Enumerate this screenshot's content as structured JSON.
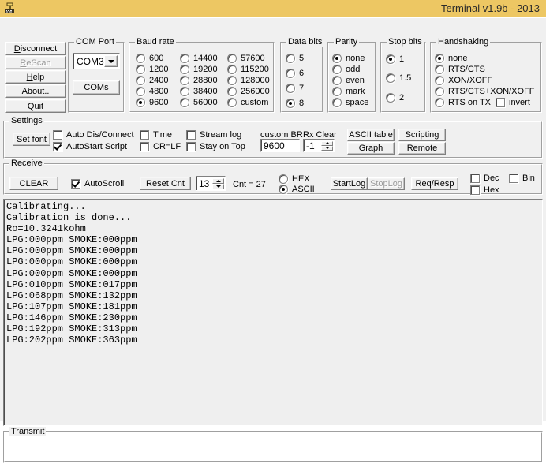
{
  "window": {
    "title": "Terminal v1.9b - 2013",
    "icon": "terminal-icon"
  },
  "connection_buttons": [
    {
      "name": "disconnect",
      "label": "Disconnect",
      "accel": "D",
      "disabled": false
    },
    {
      "name": "rescan",
      "label": "ReScan",
      "accel": "R",
      "disabled": true
    },
    {
      "name": "help",
      "label": "Help",
      "accel": "H",
      "disabled": false
    },
    {
      "name": "about",
      "label": "About..",
      "accel": "A",
      "disabled": false
    },
    {
      "name": "quit",
      "label": "Quit",
      "accel": "Q",
      "disabled": false
    }
  ],
  "com_port": {
    "legend": "COM Port",
    "selected": "COM3",
    "coms_button": "COMs"
  },
  "baud_rate": {
    "legend": "Baud rate",
    "selected": "9600",
    "columns": [
      [
        "600",
        "1200",
        "2400",
        "4800",
        "9600"
      ],
      [
        "14400",
        "19200",
        "28800",
        "38400",
        "56000"
      ],
      [
        "57600",
        "115200",
        "128000",
        "256000",
        "custom"
      ]
    ]
  },
  "data_bits": {
    "legend": "Data bits",
    "selected": "8",
    "options": [
      "5",
      "6",
      "7",
      "8"
    ]
  },
  "parity": {
    "legend": "Parity",
    "selected": "none",
    "options": [
      "none",
      "odd",
      "even",
      "mark",
      "space"
    ]
  },
  "stop_bits": {
    "legend": "Stop bits",
    "selected": "1",
    "options": [
      "1",
      "1.5",
      "2"
    ]
  },
  "handshaking": {
    "legend": "Handshaking",
    "selected": "none",
    "options": [
      "none",
      "RTS/CTS",
      "XON/XOFF",
      "RTS/CTS+XON/XOFF",
      "RTS on TX"
    ],
    "invert_label": "invert",
    "invert_checked": false
  },
  "settings": {
    "legend": "Settings",
    "set_font_button": "Set font",
    "checkboxes": [
      {
        "name": "auto-dis-connect",
        "label": "Auto Dis/Connect",
        "checked": false
      },
      {
        "name": "autostart-script",
        "label": "AutoStart Script",
        "checked": true
      },
      {
        "name": "time",
        "label": "Time",
        "checked": false
      },
      {
        "name": "cr-lf",
        "label": "CR=LF",
        "checked": false
      },
      {
        "name": "stream-log",
        "label": "Stream log",
        "checked": false
      },
      {
        "name": "stay-on-top",
        "label": "Stay on Top",
        "checked": false
      }
    ],
    "custom_br_label": "custom BR",
    "custom_br_value": "9600",
    "rx_clear_label": "Rx Clear",
    "rx_clear_value": "-1",
    "buttons": [
      {
        "name": "ascii-table",
        "label": "ASCII table"
      },
      {
        "name": "scripting",
        "label": "Scripting"
      },
      {
        "name": "graph",
        "label": "Graph"
      },
      {
        "name": "remote",
        "label": "Remote"
      }
    ]
  },
  "receive": {
    "legend": "Receive",
    "clear_button": "CLEAR",
    "autoscroll_label": "AutoScroll",
    "autoscroll_checked": true,
    "reset_cnt_button": "Reset Cnt",
    "cnt_spin_value": "13",
    "cnt_label": "Cnt =  27",
    "format_selected": "ASCII",
    "format_options": [
      "HEX",
      "ASCII"
    ],
    "startlog_button": "StartLog",
    "stoplog_button": "StopLog",
    "stoplog_disabled": true,
    "reqresp_button": "Req/Resp",
    "dec_label": "Dec",
    "dec_checked": false,
    "hex_label": "Hex",
    "hex_checked": false,
    "bin_label": "Bin",
    "bin_checked": false,
    "output_lines": [
      "Calibrating...",
      "Calibration is done...",
      "Ro=10.3241kohm",
      "LPG:000ppm SMOKE:000ppm",
      "LPG:000ppm SMOKE:000ppm",
      "LPG:000ppm SMOKE:000ppm",
      "LPG:000ppm SMOKE:000ppm",
      "LPG:010ppm SMOKE:017ppm",
      "LPG:068ppm SMOKE:132ppm",
      "LPG:107ppm SMOKE:181ppm",
      "LPG:146ppm SMOKE:230ppm",
      "LPG:192ppm SMOKE:313ppm",
      "LPG:202ppm SMOKE:363ppm"
    ]
  },
  "transmit": {
    "legend": "Transmit"
  },
  "colors": {
    "titlebar": "#edc763",
    "dialog_bg": "#f0f0f0",
    "output_bg": "#efefef"
  }
}
